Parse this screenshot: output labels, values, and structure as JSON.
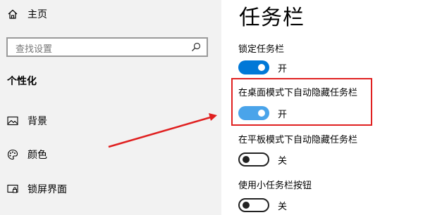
{
  "sidebar": {
    "home_label": "主页",
    "search_placeholder": "查找设置",
    "section_title": "个性化",
    "items": [
      {
        "label": "背景",
        "icon": "image-icon"
      },
      {
        "label": "颜色",
        "icon": "palette-icon"
      },
      {
        "label": "锁屏界面",
        "icon": "lock-screen-icon"
      }
    ]
  },
  "main": {
    "title": "任务栏",
    "settings": [
      {
        "label": "锁定任务栏",
        "state": "开",
        "on": true
      },
      {
        "label": "在桌面模式下自动隐藏任务栏",
        "state": "开",
        "on": true
      },
      {
        "label": "在平板模式下自动隐藏任务栏",
        "state": "关",
        "on": false
      },
      {
        "label": "使用小任务栏按钮",
        "state": "关",
        "on": false
      }
    ]
  },
  "annotation": {
    "highlight_color": "#e02020",
    "arrow_color": "#e02020"
  }
}
